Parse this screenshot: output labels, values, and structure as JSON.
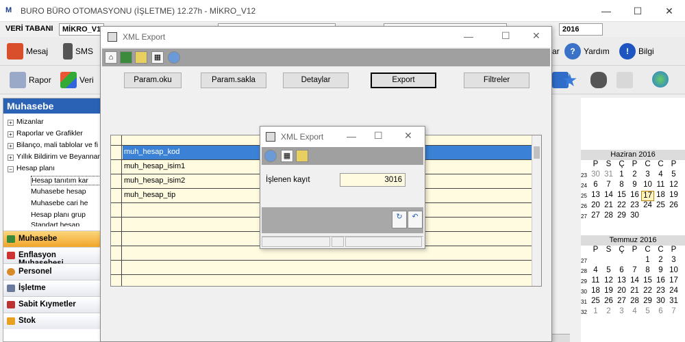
{
  "app": {
    "logo": "M",
    "title": "BURO BÜRO OTOMASYONU (İŞLETME) 12.27h - MİKRO_V12",
    "min": "—",
    "max": "☐",
    "close": "✕"
  },
  "topbar": {
    "db_label": "VERİ TABANI",
    "db_value": "MİKRO_V1",
    "year": "2016"
  },
  "toolbar1": {
    "mesaj": "Mesaj",
    "sms": "SMS",
    "ar": "ar",
    "yardim": "Yardım",
    "bilgi": "Bilgi"
  },
  "toolbar2": {
    "rapor": "Rapor",
    "veri": "Veri"
  },
  "leftpanel": {
    "title": "Muhasebe",
    "tree": [
      {
        "box": "+",
        "label": "Mizanlar"
      },
      {
        "box": "+",
        "label": "Raporlar ve Grafikler"
      },
      {
        "box": "+",
        "label": "Bilanço, mali tablolar ve fi"
      },
      {
        "box": "+",
        "label": "Yıllık Bildirim ve Beyannam"
      },
      {
        "box": "−",
        "label": "Hesap planı"
      }
    ],
    "subtree": [
      "Hesap tanıtım kar",
      "Muhasebe hesap",
      "Muhasebe cari he",
      "Hesap planı grup",
      "Standart hesap"
    ],
    "modules": [
      "Muhasebe",
      "Enflasyon Muhasebesi",
      "Personel",
      "İşletme",
      "Sabit Kıymetler",
      "Stok"
    ]
  },
  "calendar": {
    "weekdays": [
      "P",
      "S",
      "Ç",
      "P",
      "C",
      "C",
      "P"
    ],
    "june": {
      "title": "Haziran 2016",
      "rows": [
        {
          "wk": "23",
          "days": [
            "30",
            "31",
            "1",
            "2",
            "3",
            "4",
            "5"
          ]
        },
        {
          "wk": "24",
          "days": [
            "6",
            "7",
            "8",
            "9",
            "10",
            "11",
            "12"
          ]
        },
        {
          "wk": "25",
          "days": [
            "13",
            "14",
            "15",
            "16",
            "17",
            "18",
            "19"
          ]
        },
        {
          "wk": "26",
          "days": [
            "20",
            "21",
            "22",
            "23",
            "24",
            "25",
            "26"
          ]
        },
        {
          "wk": "27",
          "days": [
            "27",
            "28",
            "29",
            "30",
            "",
            "",
            ""
          ]
        }
      ]
    },
    "july": {
      "title": "Temmuz 2016",
      "rows": [
        {
          "wk": "27",
          "days": [
            "",
            "",
            "",
            "",
            "1",
            "2",
            "3"
          ]
        },
        {
          "wk": "28",
          "days": [
            "4",
            "5",
            "6",
            "7",
            "8",
            "9",
            "10"
          ]
        },
        {
          "wk": "29",
          "days": [
            "11",
            "12",
            "13",
            "14",
            "15",
            "16",
            "17"
          ]
        },
        {
          "wk": "30",
          "days": [
            "18",
            "19",
            "20",
            "21",
            "22",
            "23",
            "24"
          ]
        },
        {
          "wk": "31",
          "days": [
            "25",
            "26",
            "27",
            "28",
            "29",
            "30",
            "31"
          ]
        },
        {
          "wk": "32",
          "days": [
            "1",
            "2",
            "3",
            "4",
            "5",
            "6",
            "7"
          ]
        }
      ]
    }
  },
  "xml_main": {
    "title": "XML Export",
    "buttons": [
      "Param.oku",
      "Param.sakla",
      "Detaylar",
      "Export",
      "Filtreler"
    ],
    "fields": [
      "muh_hesap_kod",
      "muh_hesap_isim1",
      "muh_hesap_isim2",
      "muh_hesap_tip"
    ]
  },
  "xml_progress": {
    "title": "XML Export",
    "label": "İşlenen kayıt",
    "value": "3016"
  }
}
